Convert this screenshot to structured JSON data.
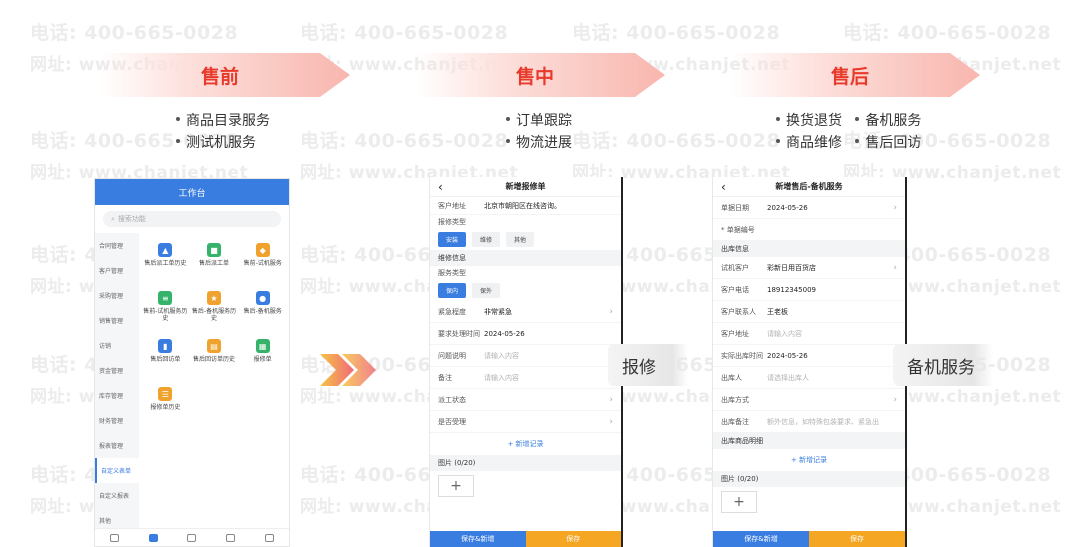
{
  "watermark": {
    "phone": "电话: 400-665-0028",
    "web": "网址: www.chanjet.net"
  },
  "stages": [
    {
      "title": "售前",
      "bullets": [
        "商品目录服务",
        "测试机服务"
      ]
    },
    {
      "title": "售中",
      "bullets": [
        "订单跟踪",
        "物流进展"
      ]
    },
    {
      "title": "售后",
      "bullets": [
        "换货退货",
        "备机服务",
        "商品维修",
        "售后回访"
      ]
    }
  ],
  "workbench": {
    "title": "工作台",
    "search_placeholder": "搜索功能",
    "sidebar": [
      "合同管理",
      "客户管理",
      "采购管理",
      "销售管理",
      "访销",
      "资金管理",
      "库存管理",
      "财务管理",
      "报表管理",
      "自定义表单",
      "自定义报表",
      "其他"
    ],
    "active_sidebar": "自定义表单",
    "apps": [
      {
        "label": "售后派工单历史",
        "color": "#3a7de0",
        "icon": "chart-icon"
      },
      {
        "label": "售后派工单",
        "color": "#35b36b",
        "icon": "save-icon"
      },
      {
        "label": "售前-试机服务",
        "color": "#f0a22e",
        "icon": "badge-icon"
      },
      {
        "label": "售前-试机服务历史",
        "color": "#35b36b",
        "icon": "document-icon"
      },
      {
        "label": "售后-备机服务历史",
        "color": "#f0a22e",
        "icon": "star-icon"
      },
      {
        "label": "售后-备机服务",
        "color": "#3a7de0",
        "icon": "users-icon"
      },
      {
        "label": "售后回访单",
        "color": "#3a7de0",
        "icon": "bar-chart-icon"
      },
      {
        "label": "售后回访单历史",
        "color": "#f0a22e",
        "icon": "file-icon"
      },
      {
        "label": "报修单",
        "color": "#35b36b",
        "icon": "grid-icon"
      },
      {
        "label": "报修单历史",
        "color": "#f0a22e",
        "icon": "list-icon"
      }
    ]
  },
  "repair": {
    "nav_title": "新增报修单",
    "side_label": "报修",
    "customer_address_label": "客户地址",
    "customer_address_value": "北京市朝阳区在线咨询。",
    "repair_type_label": "报修类型",
    "repair_types": [
      "安装",
      "维修",
      "其他"
    ],
    "repair_info_section": "维修信息",
    "service_type_label": "服务类型",
    "service_types": [
      "保内",
      "保外"
    ],
    "urgency_label": "紧急程度",
    "urgency_value": "非常紧急",
    "deadline_label": "要求处理时间",
    "deadline_value": "2024-05-26",
    "problem_label": "问题说明",
    "problem_placeholder": "请输入内容",
    "remark_label": "备注",
    "remark_placeholder": "请输入内容",
    "dispatch_label": "派工状态",
    "accepted_label": "是否受理",
    "add_record": "新增记录",
    "images_label": "图片 (0/20)",
    "save_new": "保存&新增",
    "save": "保存"
  },
  "backup": {
    "nav_title": "新增售后-备机服务",
    "side_label": "备机服务",
    "date_label": "单据日期",
    "date_value": "2024-05-26",
    "number_label": "* 单据编号",
    "outbound_section": "出库信息",
    "customer_label": "试机客户",
    "customer_value": "彩新日用百货店",
    "phone_label": "客户电话",
    "phone_value": "18912345009",
    "contact_label": "客户联系人",
    "contact_value": "王老板",
    "address_label": "客户地址",
    "address_placeholder": "请输入内容",
    "out_time_label": "实际出库时间",
    "out_time_value": "2024-05-26",
    "out_person_label": "出库人",
    "out_person_placeholder": "请选择出库人",
    "out_method_label": "出库方式",
    "out_remark_label": "出库备注",
    "out_remark_placeholder": "额外信息，如特殊包装要求、紧急出",
    "goods_section": "出库商品明细",
    "add_record": "新增记录",
    "images_label": "图片 (0/20)",
    "save_new": "保存&新增",
    "save": "保存"
  }
}
